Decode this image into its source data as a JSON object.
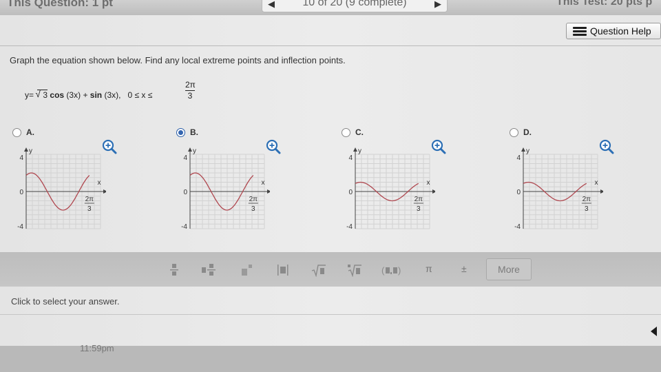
{
  "header": {
    "question_label": "This Question: 1 pt",
    "progress": "10 of 20 (9 complete)",
    "test_label": "This Test: 20 pts p"
  },
  "help": {
    "label": "Question Help",
    "icon": "list-icon"
  },
  "question": {
    "instruction": "Graph the equation shown below. Find any local extreme points and inflection points.",
    "eq_prefix": "y=",
    "eq_sqrt_arg": "3",
    "eq_cos": "cos",
    "eq_cos_arg": "(3x)",
    "eq_plus": "+",
    "eq_sin": "sin",
    "eq_sin_arg": "(3x),",
    "eq_domain": "0 ≤ x ≤",
    "eq_frac_num": "2π",
    "eq_frac_den": "3"
  },
  "options": [
    {
      "letter": "A.",
      "selected": false,
      "ytick_top": "4",
      "ytick_zero": "0",
      "ytick_bot": "-4",
      "ylabel": "y",
      "xlabel": "x",
      "frac_num": "2π",
      "frac_den": "3",
      "amplitude": 2,
      "phase_sign": -1
    },
    {
      "letter": "B.",
      "selected": true,
      "ytick_top": "4",
      "ytick_zero": "0",
      "ytick_bot": "-4",
      "ylabel": "y",
      "xlabel": "x",
      "frac_num": "2π",
      "frac_den": "3",
      "amplitude": 2,
      "phase_sign": 1
    },
    {
      "letter": "C.",
      "selected": false,
      "ytick_top": "4",
      "ytick_zero": "0",
      "ytick_bot": "-4",
      "ylabel": "y",
      "xlabel": "x",
      "frac_num": "2π",
      "frac_den": "3",
      "amplitude": 1,
      "phase_sign": -1
    },
    {
      "letter": "D.",
      "selected": false,
      "ytick_top": "4",
      "ytick_zero": "0",
      "ytick_bot": "-4",
      "ylabel": "y",
      "xlabel": "x",
      "frac_num": "2π",
      "frac_den": "3",
      "amplitude": 1,
      "phase_sign": 1
    }
  ],
  "toolbar": {
    "tools": [
      "fraction",
      "mixed-number",
      "exponent",
      "absolute-value",
      "square-root",
      "nth-root",
      "ordered-pair",
      "π",
      "±"
    ],
    "pi": "π",
    "plus_minus": "±",
    "more": "More"
  },
  "status": {
    "message": "Click to select your answer."
  },
  "footer": {
    "time": "11:59pm"
  },
  "colors": {
    "curve": "#b0474f",
    "grid": "#d2d2d2",
    "accent": "#2c6fb5"
  }
}
